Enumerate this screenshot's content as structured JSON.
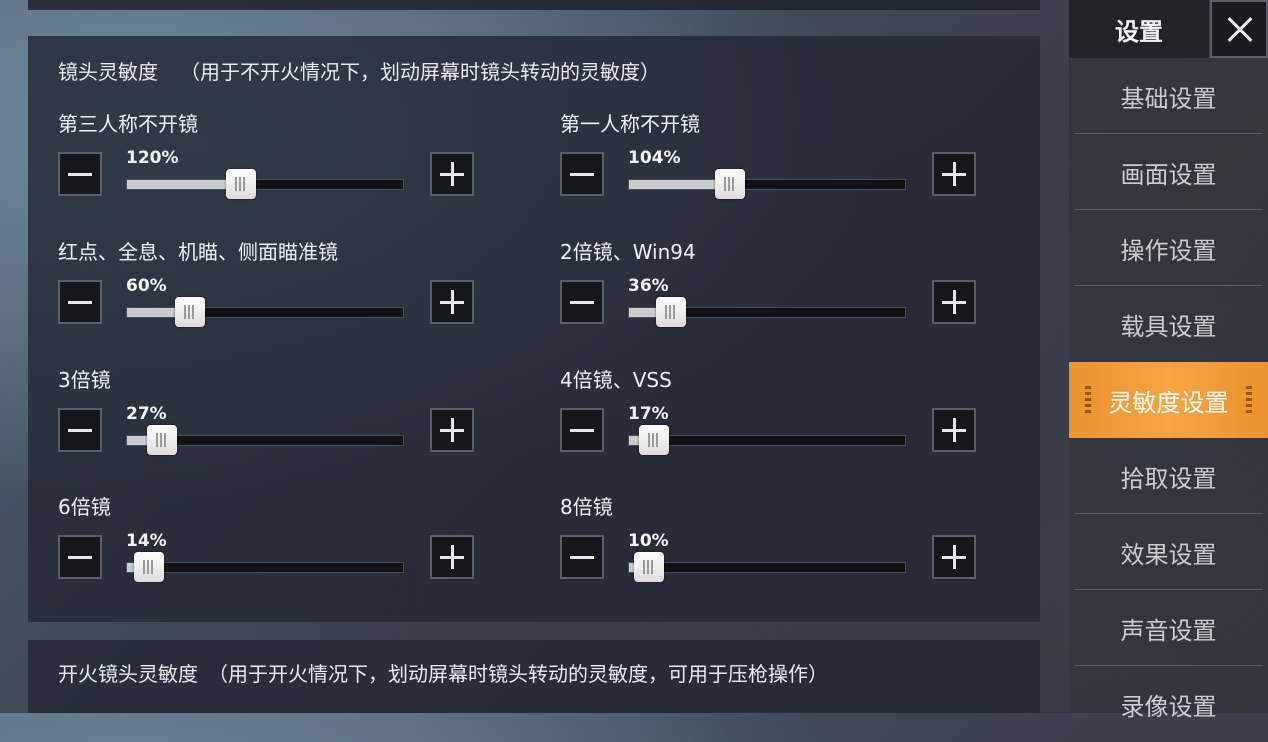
{
  "section": {
    "title": "镜头灵敏度",
    "note": "（用于不开火情况下，划动屏幕时镜头转动的灵敏度）"
  },
  "sliders": [
    {
      "label": "第三人称不开镜",
      "value_text": "120%",
      "fraction": 0.4
    },
    {
      "label": "第一人称不开镜",
      "value_text": "104%",
      "fraction": 0.35
    },
    {
      "label": "红点、全息、机瞄、侧面瞄准镜",
      "value_text": "60%",
      "fraction": 0.2
    },
    {
      "label": "2倍镜、Win94",
      "value_text": "36%",
      "fraction": 0.12
    },
    {
      "label": "3倍镜",
      "value_text": "27%",
      "fraction": 0.09
    },
    {
      "label": "4倍镜、VSS",
      "value_text": "17%",
      "fraction": 0.05
    },
    {
      "label": "6倍镜",
      "value_text": "14%",
      "fraction": 0.04
    },
    {
      "label": "8倍镜",
      "value_text": "10%",
      "fraction": 0.03
    }
  ],
  "section2": {
    "title": "开火镜头灵敏度",
    "note": "（用于开火情况下，划动屏幕时镜头转动的灵敏度，可用于压枪操作）"
  },
  "sidebar": {
    "title": "设置",
    "items": [
      {
        "label": "基础设置"
      },
      {
        "label": "画面设置"
      },
      {
        "label": "操作设置"
      },
      {
        "label": "载具设置"
      },
      {
        "label": "灵敏度设置",
        "active": true
      },
      {
        "label": "拾取设置"
      },
      {
        "label": "效果设置"
      },
      {
        "label": "声音设置"
      },
      {
        "label": "录像设置"
      }
    ]
  },
  "colors": {
    "accent": "#f2a040",
    "panel": "#23283a"
  }
}
